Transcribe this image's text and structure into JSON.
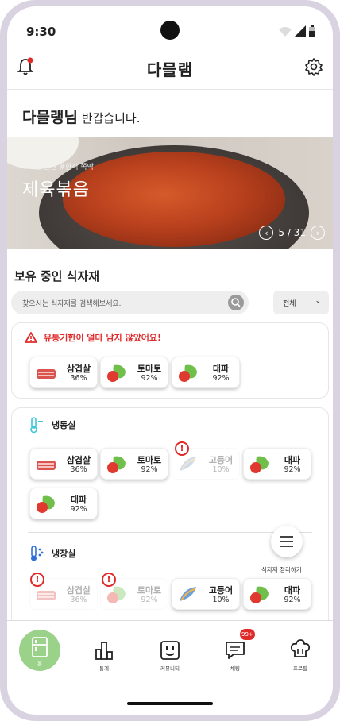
{
  "status": {
    "time": "9:30"
  },
  "header": {
    "logo": "다믈램"
  },
  "greeting": {
    "name": "다믈랭님",
    "message": "반갑습니다."
  },
  "banner": {
    "hashtags": "#국민 반찬 #한식 쪽딱",
    "dish": "제육볶음",
    "page": "5 / 31"
  },
  "inventory": {
    "title": "보유 중인 식자재",
    "search_placeholder": "찾으시는 식자재를 검색해보세요.",
    "filter": "전체"
  },
  "warning": {
    "message": "유통기한이 얼마 남지 않았어요!",
    "items": [
      {
        "name": "삼겹살",
        "pct": "36%",
        "icon": "pork-icon"
      },
      {
        "name": "토마토",
        "pct": "92%",
        "icon": "tomato-lettuce-icon"
      },
      {
        "name": "대파",
        "pct": "92%",
        "icon": "green-onion-icon"
      }
    ]
  },
  "freezer": {
    "label": "냉동실",
    "items": [
      {
        "name": "삼겹살",
        "pct": "36%"
      },
      {
        "name": "토마토",
        "pct": "92%"
      },
      {
        "name": "고등어",
        "pct": "10%"
      },
      {
        "name": "대파",
        "pct": "92%"
      },
      {
        "name": "대파",
        "pct": "92%"
      }
    ]
  },
  "fridge": {
    "label": "냉장실",
    "items": [
      {
        "name": "삼겹살",
        "pct": "36%"
      },
      {
        "name": "토마토",
        "pct": "92%"
      },
      {
        "name": "고등어",
        "pct": "10%"
      },
      {
        "name": "대파",
        "pct": "92%"
      }
    ]
  },
  "fab": {
    "label": "식자재 정리하기"
  },
  "tabs": {
    "home": "홈",
    "stats": "통계",
    "community": "커뮤니티",
    "chat": "채팅",
    "chat_badge": "99+",
    "profile": "프로필"
  },
  "colors": {
    "accent": "#9bd28a",
    "warning": "#e02a2a"
  }
}
